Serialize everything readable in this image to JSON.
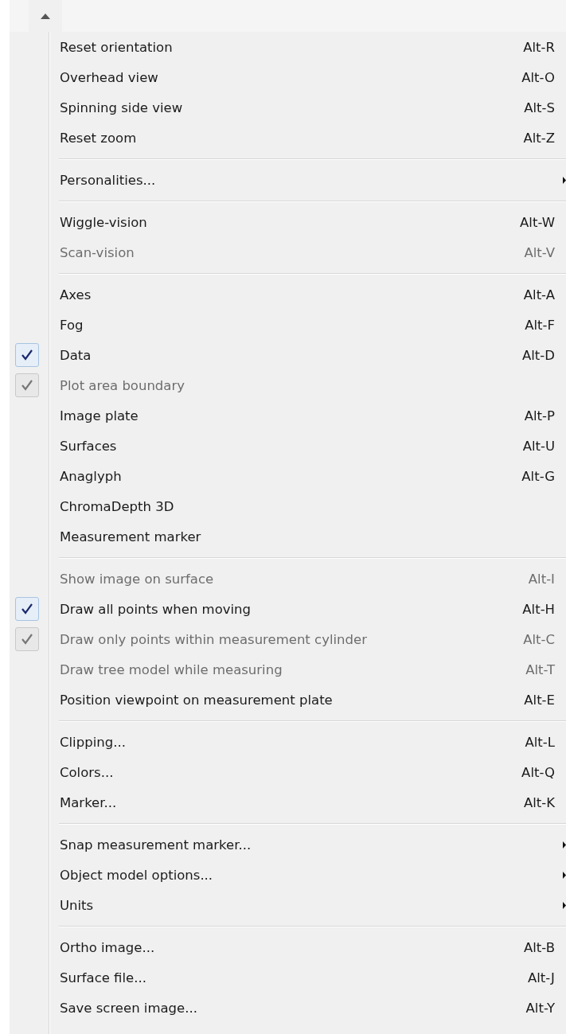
{
  "menu": {
    "groups": [
      {
        "items": [
          {
            "label": "Reset orientation",
            "shortcut": "Alt-R",
            "checked": false,
            "disabled": false,
            "submenu": false
          },
          {
            "label": "Overhead view",
            "shortcut": "Alt-O",
            "checked": false,
            "disabled": false,
            "submenu": false
          },
          {
            "label": "Spinning side view",
            "shortcut": "Alt-S",
            "checked": false,
            "disabled": false,
            "submenu": false
          },
          {
            "label": "Reset zoom",
            "shortcut": "Alt-Z",
            "checked": false,
            "disabled": false,
            "submenu": false
          }
        ]
      },
      {
        "items": [
          {
            "label": "Personalities...",
            "checked": false,
            "disabled": false,
            "submenu": true
          }
        ]
      },
      {
        "items": [
          {
            "label": "Wiggle-vision",
            "shortcut": "Alt-W",
            "checked": false,
            "disabled": false,
            "submenu": false
          },
          {
            "label": "Scan-vision",
            "shortcut": "Alt-V",
            "checked": false,
            "disabled": true,
            "submenu": false
          }
        ]
      },
      {
        "items": [
          {
            "label": "Axes",
            "shortcut": "Alt-A",
            "checked": false,
            "disabled": false,
            "submenu": false
          },
          {
            "label": "Fog",
            "shortcut": "Alt-F",
            "checked": false,
            "disabled": false,
            "submenu": false
          },
          {
            "label": "Data",
            "shortcut": "Alt-D",
            "checked": true,
            "disabled": false,
            "submenu": false
          },
          {
            "label": "Plot area boundary",
            "checked": true,
            "disabled": true,
            "submenu": false
          },
          {
            "label": "Image plate",
            "shortcut": "Alt-P",
            "checked": false,
            "disabled": false,
            "submenu": false
          },
          {
            "label": "Surfaces",
            "shortcut": "Alt-U",
            "checked": false,
            "disabled": false,
            "submenu": false
          },
          {
            "label": "Anaglyph",
            "shortcut": "Alt-G",
            "checked": false,
            "disabled": false,
            "submenu": false
          },
          {
            "label": "ChromaDepth 3D",
            "checked": false,
            "disabled": false,
            "submenu": false
          },
          {
            "label": "Measurement marker",
            "checked": false,
            "disabled": false,
            "submenu": false
          }
        ]
      },
      {
        "items": [
          {
            "label": "Show image on surface",
            "shortcut": "Alt-I",
            "checked": false,
            "disabled": true,
            "submenu": false
          },
          {
            "label": "Draw all points when moving",
            "shortcut": "Alt-H",
            "checked": true,
            "disabled": false,
            "submenu": false
          },
          {
            "label": "Draw only points within measurement cylinder",
            "shortcut": "Alt-C",
            "checked": true,
            "disabled": true,
            "submenu": false
          },
          {
            "label": "Draw tree model while measuring",
            "shortcut": "Alt-T",
            "checked": false,
            "disabled": true,
            "submenu": false
          },
          {
            "label": "Position viewpoint on measurement plate",
            "shortcut": "Alt-E",
            "checked": false,
            "disabled": false,
            "submenu": false
          }
        ]
      },
      {
        "items": [
          {
            "label": "Clipping...",
            "shortcut": "Alt-L",
            "checked": false,
            "disabled": false,
            "submenu": false
          },
          {
            "label": "Colors...",
            "shortcut": "Alt-Q",
            "checked": false,
            "disabled": false,
            "submenu": false
          },
          {
            "label": "Marker...",
            "shortcut": "Alt-K",
            "checked": false,
            "disabled": false,
            "submenu": false
          }
        ]
      },
      {
        "items": [
          {
            "label": "Snap measurement marker...",
            "checked": false,
            "disabled": false,
            "submenu": true
          },
          {
            "label": "Object model options...",
            "checked": false,
            "disabled": false,
            "submenu": true
          },
          {
            "label": "Units",
            "checked": false,
            "disabled": false,
            "submenu": true
          }
        ]
      },
      {
        "items": [
          {
            "label": "Ortho image...",
            "shortcut": "Alt-B",
            "checked": false,
            "disabled": false,
            "submenu": false
          },
          {
            "label": "Surface file...",
            "shortcut": "Alt-J",
            "checked": false,
            "disabled": false,
            "submenu": false
          },
          {
            "label": "Save screen image...",
            "shortcut": "Alt-Y",
            "checked": false,
            "disabled": false,
            "submenu": false
          }
        ]
      }
    ]
  }
}
